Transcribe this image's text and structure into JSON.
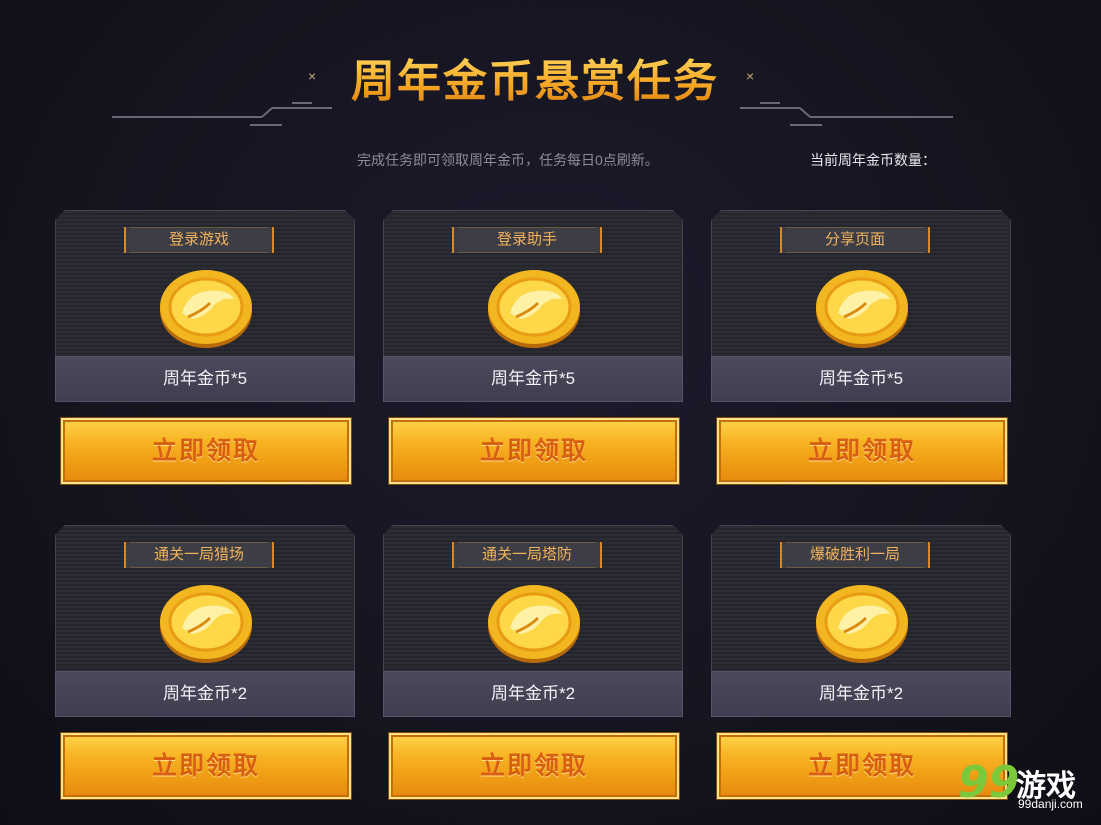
{
  "header": {
    "title": "周年金币悬赏任务",
    "close_mark": "×",
    "subtitle": "完成任务即可领取周年金币，任务每日0点刷新。",
    "coin_count_label": "当前周年金币数量："
  },
  "tasks": [
    {
      "label": "登录游戏",
      "reward": "周年金币*5",
      "button": "立即领取"
    },
    {
      "label": "登录助手",
      "reward": "周年金币*5",
      "button": "立即领取"
    },
    {
      "label": "分享页面",
      "reward": "周年金币*5",
      "button": "立即领取"
    },
    {
      "label": "通关一局猎场",
      "reward": "周年金币*2",
      "button": "立即领取"
    },
    {
      "label": "通关一局塔防",
      "reward": "周年金币*2",
      "button": "立即领取"
    },
    {
      "label": "爆破胜利一局",
      "reward": "周年金币*2",
      "button": "立即领取"
    }
  ],
  "watermark": {
    "number": "99",
    "text": "游戏",
    "domain": "99danji.com"
  },
  "colors": {
    "gold": "#f6a623",
    "label_orange": "#f2b25a",
    "button_text": "#d85f12"
  },
  "icons": {
    "coin": "gold-coin-icon",
    "close": "close-icon"
  }
}
